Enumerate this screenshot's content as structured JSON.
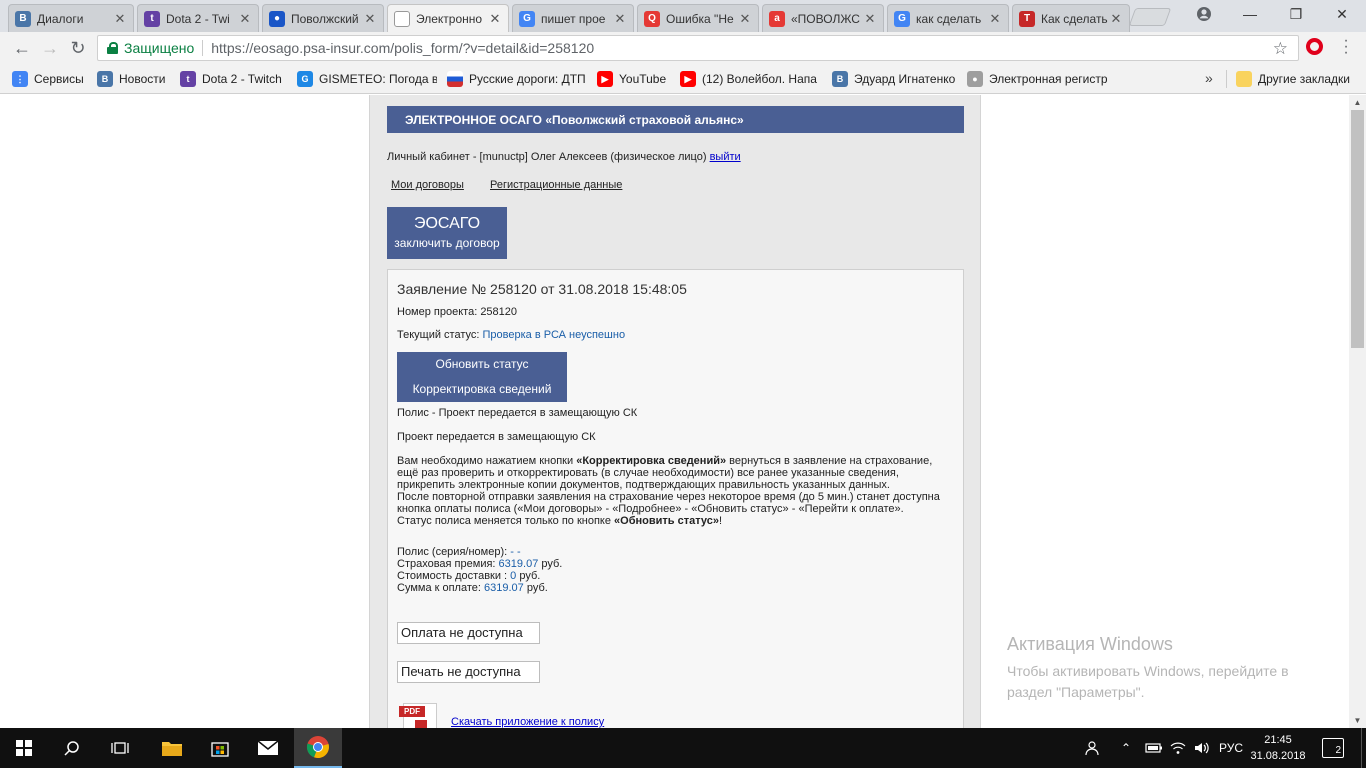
{
  "browser": {
    "tabs": [
      {
        "title": "Диалоги",
        "icon": "vk-icon",
        "color": "#4a76a8",
        "active": false
      },
      {
        "title": "Dota 2 - Twi",
        "icon": "twitch-icon",
        "color": "#6441a4",
        "active": false
      },
      {
        "title": "Поволжский",
        "icon": "drop-icon",
        "color": "#1a56c7",
        "active": false
      },
      {
        "title": "Электронно",
        "icon": "page-icon",
        "color": "#ffffff",
        "active": true
      },
      {
        "title": "пишет прое",
        "icon": "google-icon",
        "color": "#4285f4",
        "active": false
      },
      {
        "title": "Ошибка \"Не",
        "icon": "search-icon",
        "color": "#e53935",
        "active": false
      },
      {
        "title": "«ПОВОЛЖС",
        "icon": "a-icon",
        "color": "#e53935",
        "active": false
      },
      {
        "title": "как сделать",
        "icon": "google-icon",
        "color": "#4285f4",
        "active": false
      },
      {
        "title": "Как сделать",
        "icon": "shield-icon",
        "color": "#c62828",
        "active": false
      }
    ],
    "secure_label": "Защищено",
    "url": "https://eosago.psa-insur.com/polis_form/?v=detail&id=258120",
    "bookmarks": [
      {
        "label": "Сервисы",
        "icon": "apps-icon",
        "color": "#4285f4"
      },
      {
        "label": "Новости",
        "icon": "vk-icon",
        "color": "#4a76a8"
      },
      {
        "label": "Dota 2 - Twitch",
        "icon": "twitch-icon",
        "color": "#6441a4"
      },
      {
        "label": "GISMETEO: Погода в",
        "icon": "gismeteo-icon",
        "color": "#1e88e5"
      },
      {
        "label": "Русские дороги: ДТП",
        "icon": "flag-icon",
        "color": "#d32f2f"
      },
      {
        "label": "YouTube",
        "icon": "youtube-icon",
        "color": "#ff0000"
      },
      {
        "label": "(12) Волейбол. Напа",
        "icon": "youtube-icon",
        "color": "#ff0000"
      },
      {
        "label": "Эдуард Игнатенко",
        "icon": "vk-icon",
        "color": "#4a76a8"
      },
      {
        "label": "Электронная регистр",
        "icon": "person-icon",
        "color": "#9e9e9e"
      }
    ],
    "overflow_chevron": "»",
    "other_bookmarks": "Другие закладки"
  },
  "page": {
    "banner": "ЭЛЕКТРОННОЕ ОСАГО «Поволжский страховой альянс»",
    "cabinet_prefix": "Личный кабинет - [munuctp] Олег Алексеев   (физическое лицо)",
    "logout": "выйти",
    "nav_contracts": "Мои договоры",
    "nav_registration": "Регистрационные данные",
    "eosago_big": "ЭОСАГО",
    "eosago_small": "заключить договор",
    "application_title": "Заявление № 258120 от 31.08.2018 15:48:05",
    "project_number_label": "Номер проекта:",
    "project_number": "258120",
    "status_label": "Текущий статус:",
    "status_value": "Проверка в РСА неуспешно",
    "btn_update_status": "Обновить статус",
    "btn_correct": "Корректировка сведений",
    "polis_msg": "Полис - Проект передается в замещающую СК",
    "project_msg": "Проект передается в замещающую СК",
    "info_1": "Вам необходимо нажатием кнопки ",
    "info_1_bold": "«Корректировка сведений»",
    "info_2": " вернуться в заявление на страхование, ещё раз проверить и откорректировать (в случае необходимости) все ранее указанные сведения, прикрепить электронные копии документов, подтверждающих правильность указанных данных.",
    "info_3": "После повторной отправки заявления на страхование через некоторое время (до 5 мин.) станет доступна кнопка оплаты полиса («Мои договоры» - «Подробнее» - «Обновить статус» - «Перейти к оплате».",
    "info_4": "Статус полиса меняется только по кнопке ",
    "info_4_bold": "«Обновить статус»",
    "info_4_end": "!",
    "policy_label": "Полис (серия/номер):",
    "policy_value": "- -",
    "premium_label": "Страховая премия:",
    "premium_value": "6319.07",
    "delivery_label": "Стоимость доставки :",
    "delivery_value": "0",
    "total_label": "Сумма к оплате:",
    "total_value": "6319.07",
    "currency": "руб.",
    "payment_unavailable": "Оплата не доступна",
    "print_unavailable": "Печать не доступна",
    "pdf_tag": "PDF",
    "download_link": "Скачать приложение к полису"
  },
  "watermark": {
    "title": "Активация Windows",
    "line1": "Чтобы активировать Windows, перейдите в",
    "line2": "раздел \"Параметры\"."
  },
  "taskbar": {
    "language": "РУС",
    "time": "21:45",
    "date": "31.08.2018",
    "notifications": "2"
  }
}
